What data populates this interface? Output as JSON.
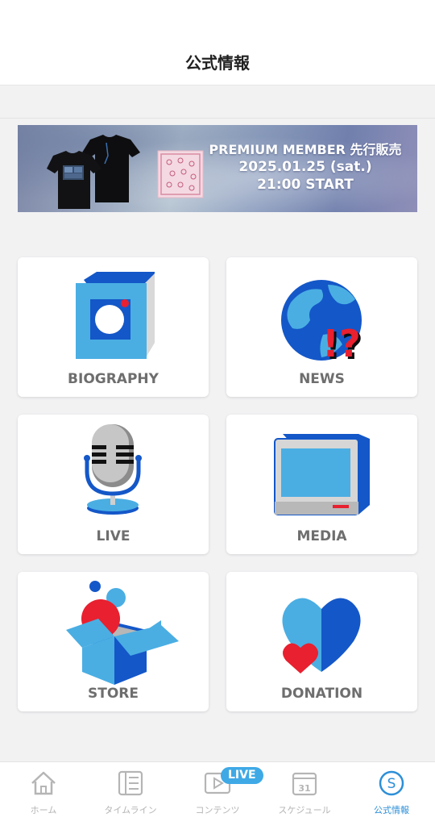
{
  "header": {
    "title": "公式情報"
  },
  "banner": {
    "line1": "PREMIUM MEMBER 先行販売",
    "line2": "2025.01.25 (sat.)",
    "line3": "21:00 START"
  },
  "cards": [
    {
      "label": "BIOGRAPHY",
      "icon": "book-icon"
    },
    {
      "label": "NEWS",
      "icon": "globe-question-icon"
    },
    {
      "label": "LIVE",
      "icon": "microphone-icon"
    },
    {
      "label": "MEDIA",
      "icon": "monitor-icon"
    },
    {
      "label": "STORE",
      "icon": "box-icon"
    },
    {
      "label": "DONATION",
      "icon": "heart-icon"
    }
  ],
  "tabbar": {
    "items": [
      {
        "label": "ホーム",
        "icon": "home-icon",
        "active": false
      },
      {
        "label": "タイムライン",
        "icon": "timeline-icon",
        "active": false
      },
      {
        "label": "コンテンツ",
        "icon": "play-icon",
        "active": false,
        "badge": "LIVE"
      },
      {
        "label": "スケジュール",
        "icon": "calendar-icon",
        "active": false,
        "calendar_day": "31"
      },
      {
        "label": "公式情報",
        "icon": "official-s-icon",
        "active": true,
        "icon_letter": "S"
      }
    ]
  },
  "colors": {
    "accent": "#2d8fd8",
    "icon_blue": "#4aaee3",
    "icon_dark_blue": "#1457c8",
    "icon_red": "#e8202f"
  }
}
